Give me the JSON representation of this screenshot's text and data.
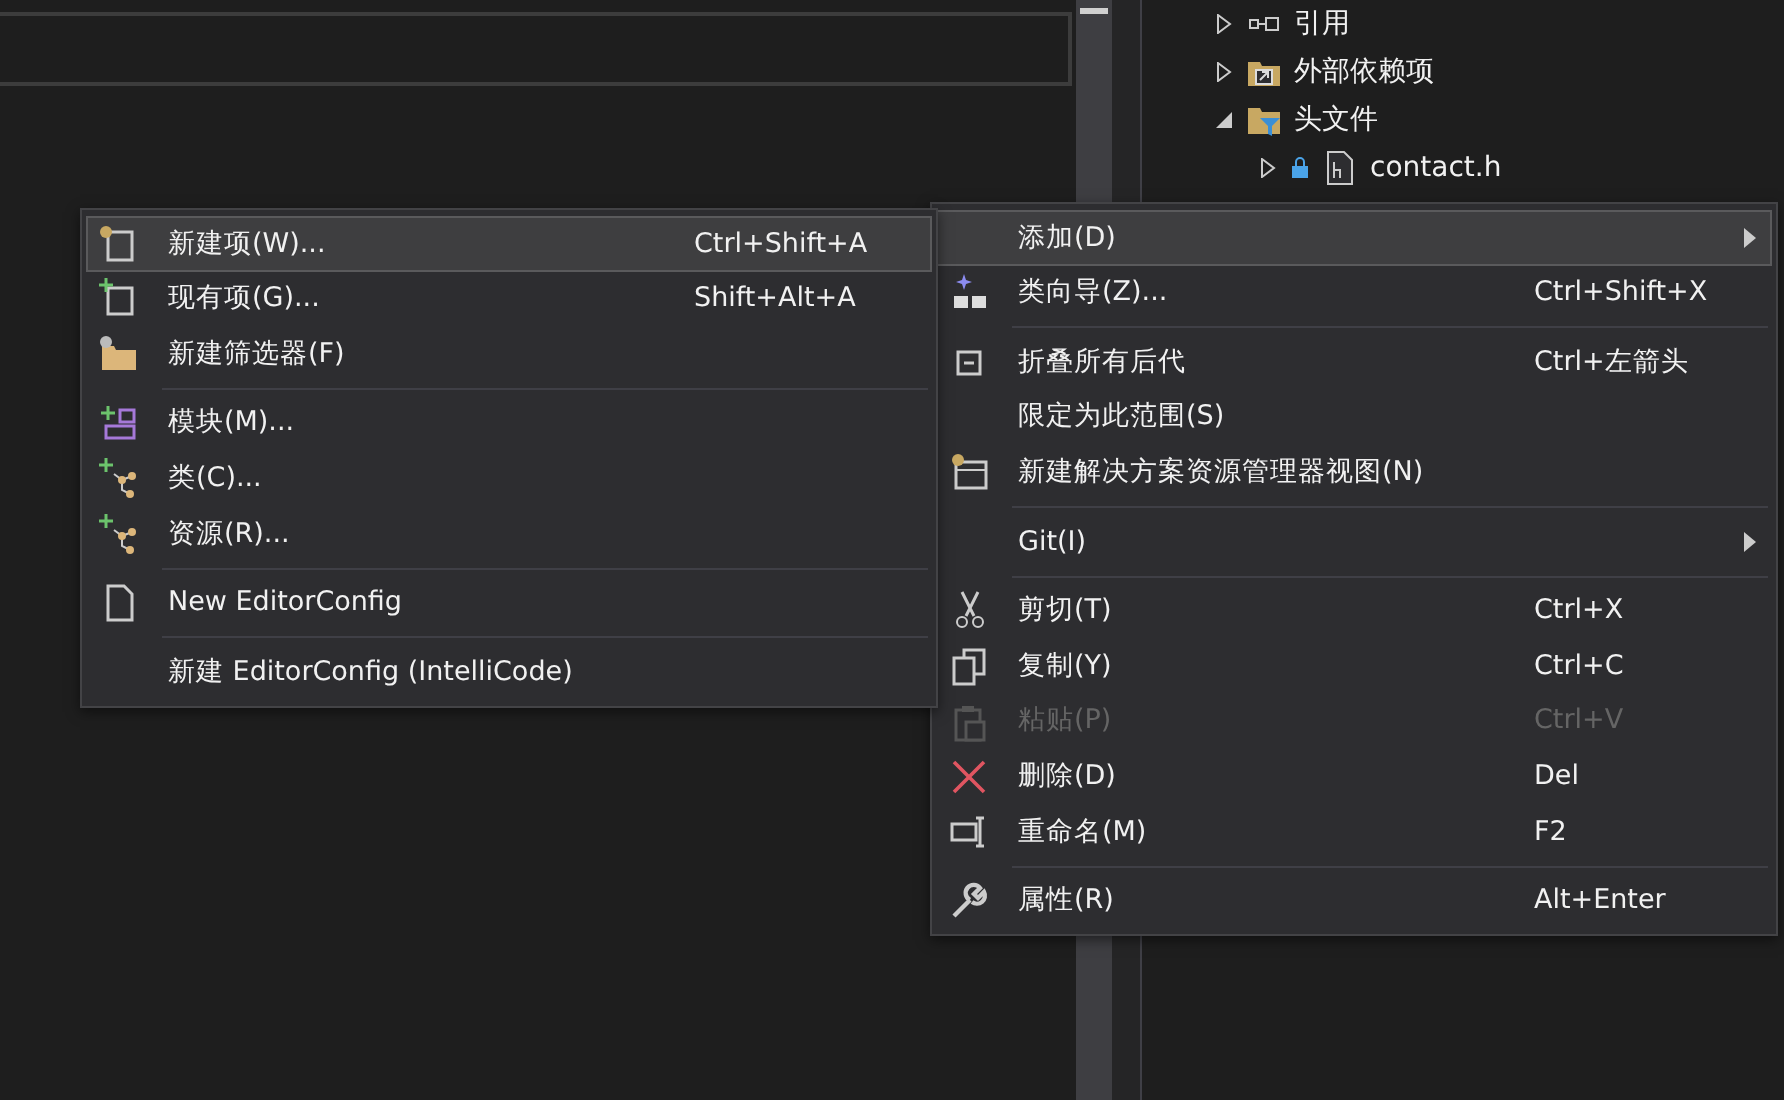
{
  "solution_tree": {
    "items": [
      {
        "label": "引用",
        "expanded": false
      },
      {
        "label": "外部依赖项",
        "expanded": false
      },
      {
        "label": "头文件",
        "expanded": true,
        "children": [
          {
            "label": "contact.h",
            "expanded": false,
            "locked": true
          }
        ]
      }
    ]
  },
  "add_submenu": {
    "items": [
      {
        "kind": "item",
        "label": "新建项(W)...",
        "shortcut": "Ctrl+Shift+A",
        "selected": true
      },
      {
        "kind": "item",
        "label": "现有项(G)...",
        "shortcut": "Shift+Alt+A",
        "selected": false
      },
      {
        "kind": "item",
        "label": "新建筛选器(F)",
        "selected": false
      },
      {
        "kind": "separator"
      },
      {
        "kind": "item",
        "label": "模块(M)...",
        "selected": false
      },
      {
        "kind": "item",
        "label": "类(C)...",
        "selected": false
      },
      {
        "kind": "item",
        "label": "资源(R)...",
        "selected": false
      },
      {
        "kind": "separator"
      },
      {
        "kind": "item",
        "label": "New EditorConfig",
        "selected": false
      },
      {
        "kind": "separator"
      },
      {
        "kind": "item",
        "label": "新建 EditorConfig (IntelliCode)",
        "selected": false
      }
    ]
  },
  "context_menu": {
    "items": [
      {
        "kind": "item",
        "label": "添加(D)",
        "submenu": true,
        "selected": true
      },
      {
        "kind": "item",
        "label": "类向导(Z)...",
        "shortcut": "Ctrl+Shift+X",
        "selected": false
      },
      {
        "kind": "separator"
      },
      {
        "kind": "item",
        "label": "折叠所有后代",
        "shortcut": "Ctrl+左箭头",
        "selected": false
      },
      {
        "kind": "item",
        "label": "限定为此范围(S)",
        "selected": false
      },
      {
        "kind": "item",
        "label": "新建解决方案资源管理器视图(N)",
        "selected": false
      },
      {
        "kind": "separator"
      },
      {
        "kind": "item",
        "label": "Git(I)",
        "submenu": true,
        "selected": false
      },
      {
        "kind": "separator"
      },
      {
        "kind": "item",
        "label": "剪切(T)",
        "shortcut": "Ctrl+X",
        "selected": false
      },
      {
        "kind": "item",
        "label": "复制(Y)",
        "shortcut": "Ctrl+C",
        "selected": false
      },
      {
        "kind": "item",
        "label": "粘贴(P)",
        "shortcut": "Ctrl+V",
        "disabled": true,
        "selected": false
      },
      {
        "kind": "item",
        "label": "删除(D)",
        "shortcut": "Del",
        "selected": false
      },
      {
        "kind": "item",
        "label": "重命名(M)",
        "shortcut": "F2",
        "selected": false
      },
      {
        "kind": "separator"
      },
      {
        "kind": "item",
        "label": "属性(R)",
        "shortcut": "Alt+Enter",
        "selected": false
      }
    ]
  }
}
